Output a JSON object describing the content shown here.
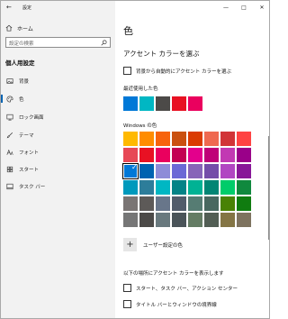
{
  "app": {
    "title": "設定"
  },
  "sidebar": {
    "home_label": "ホーム",
    "search_placeholder": "設定の検索",
    "section_heading": "個人用設定",
    "items": [
      {
        "label": "背景",
        "icon": "picture-icon"
      },
      {
        "label": "色",
        "icon": "palette-icon",
        "selected": true
      },
      {
        "label": "ロック画面",
        "icon": "lock-screen-icon"
      },
      {
        "label": "テーマ",
        "icon": "brush-icon"
      },
      {
        "label": "フォント",
        "icon": "font-icon"
      },
      {
        "label": "スタート",
        "icon": "start-icon"
      },
      {
        "label": "タスク バー",
        "icon": "taskbar-icon"
      }
    ]
  },
  "main": {
    "page_title": "色",
    "accent_heading": "アクセント カラーを選ぶ",
    "auto_accent_label": "背景から自動的にアクセント カラーを選ぶ",
    "recent_heading": "最近使用した色",
    "recent_colors": [
      "#0078d7",
      "#00b7c3",
      "#4c4a48",
      "#e81123",
      "#ea005e"
    ],
    "windows_heading": "Windows の色",
    "windows_colors": [
      [
        "#ffb900",
        "#ff8c00",
        "#f7630c",
        "#ca5010",
        "#da3b01",
        "#ef6950",
        "#d13438",
        "#ff4343"
      ],
      [
        "#e74856",
        "#e81123",
        "#ea005e",
        "#c30052",
        "#e3008c",
        "#bf0077",
        "#c239b3",
        "#9a0089"
      ],
      [
        "#0078d7",
        "#0063b1",
        "#8e8cd8",
        "#6b69d6",
        "#8764b8",
        "#744da9",
        "#b146c2",
        "#881798"
      ],
      [
        "#0099bc",
        "#2d7d9a",
        "#00b7c3",
        "#038387",
        "#00b294",
        "#018574",
        "#00cc6a",
        "#10893e"
      ],
      [
        "#7a7574",
        "#5d5a58",
        "#68768a",
        "#515c6b",
        "#567c73",
        "#486860",
        "#498205",
        "#107c10"
      ],
      [
        "#767676",
        "#4c4a48",
        "#69797e",
        "#4a5459",
        "#647c64",
        "#525e54",
        "#847545",
        "#7e735f"
      ]
    ],
    "selected_color": "#0078d7",
    "custom_color_label": "ユーザー設定の色",
    "show_on_heading": "以下の場所にアクセント カラーを表示します",
    "show_start_label": "スタート、タスク バー、アクション センター",
    "show_title_label": "タイトル バーとウィンドウの境界線"
  }
}
